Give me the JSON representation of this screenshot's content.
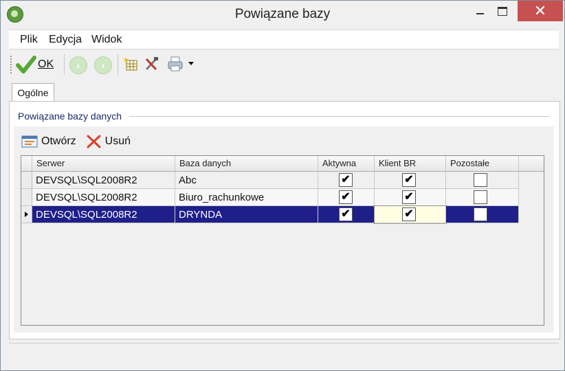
{
  "window": {
    "title": "Powiązane bazy",
    "close_glyph": "✕"
  },
  "menu": {
    "items": [
      {
        "label": "Plik"
      },
      {
        "label": "Edycja"
      },
      {
        "label": "Widok"
      }
    ]
  },
  "toolbar": {
    "ok_label": "OK"
  },
  "tabs": [
    {
      "label": "Ogólne",
      "active": true
    }
  ],
  "group": {
    "title": "Powiązane bazy danych"
  },
  "actions": {
    "open_label": "Otwórz",
    "delete_label": "Usuń"
  },
  "grid": {
    "columns": [
      "Serwer",
      "Baza danych",
      "Aktywna",
      "Klient BR",
      "Pozostałe"
    ],
    "rows": [
      {
        "server": "DEVSQL\\SQL2008R2",
        "database": "Abc",
        "active": true,
        "client_br": true,
        "other": false
      },
      {
        "server": "DEVSQL\\SQL2008R2",
        "database": "Biuro_rachunkowe",
        "active": true,
        "client_br": true,
        "other": false
      },
      {
        "server": "DEVSQL\\SQL2008R2",
        "database": "DRYNDA",
        "active": true,
        "client_br": true,
        "other": false,
        "selected": true
      }
    ]
  },
  "colors": {
    "selection": "#1f1f8a",
    "close_button": "#c75050",
    "group_title": "#1a2a6a"
  }
}
